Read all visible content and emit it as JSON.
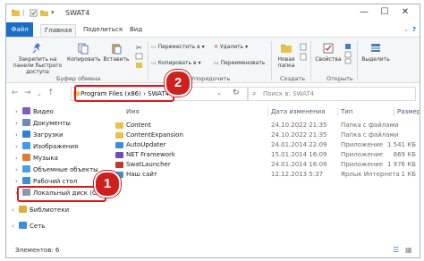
{
  "window": {
    "title": "SWAT4",
    "controls": [
      "—",
      "☐",
      "✕"
    ]
  },
  "ribbon_tabs": [
    "Файл",
    "Главная",
    "Поделиться",
    "Вид"
  ],
  "ribbon": {
    "pin_label": "Закрепить на панели быстрого доступа",
    "copy_label": "Копировать",
    "paste_label": "Вставить",
    "clipboard_group": "Буфер обмена",
    "move_to_label": "Переместить в",
    "copy_to_label": "Копировать в",
    "delete_label": "Удалить",
    "rename_label": "Переименовать",
    "organize_group": "Упорядочить",
    "new_folder_label": "Новая папка",
    "create_group": "Создать",
    "properties_label": "Свойства",
    "open_group": "Открыть",
    "select_label": "Выделить"
  },
  "address": {
    "path_part1": "Program Files (x86)",
    "separator": "›",
    "path_part2": "SWAT4",
    "search_placeholder": "Поиск в: SWAT4"
  },
  "nav": {
    "items": [
      {
        "label": "Видео",
        "color": "#7b5fc4"
      },
      {
        "label": "Документы",
        "color": "#6b8bb8"
      },
      {
        "label": "Загрузки",
        "color": "#2f7fd4"
      },
      {
        "label": "Изображения",
        "color": "#3d9be8"
      },
      {
        "label": "Музыка",
        "color": "#e07c2a"
      },
      {
        "label": "Объемные объекты",
        "color": "#4aa0e0"
      },
      {
        "label": "Рабочий стол",
        "color": "#3d8ed8"
      },
      {
        "label": "Локальный диск (C:)",
        "color": "#8a9aaa"
      },
      {
        "label": "Библиотеки",
        "color": "#d8b040"
      },
      {
        "label": "Сеть",
        "color": "#3d8ed8"
      }
    ]
  },
  "columns": {
    "name": "Имя",
    "date": "Дата изменения",
    "type": "Тип",
    "size": "Размер"
  },
  "files": [
    {
      "name": "Content",
      "date": "24.10.2022 21:35",
      "type": "Папка с файлами",
      "size": "",
      "color": "#e8c14a"
    },
    {
      "name": "ContentExpansion",
      "date": "24.10.2022 21:35",
      "type": "Папка с файлами",
      "size": "",
      "color": "#e8c14a"
    },
    {
      "name": "AutoUpdater",
      "date": "24.01.2014 22:09",
      "type": "Приложение",
      "size": "1 541 КБ",
      "color": "#3a8fd8"
    },
    {
      "name": "NET Framework",
      "date": "15.01.2014 16:09",
      "type": "Приложение",
      "size": "869 КБ",
      "color": "#6a4fb8"
    },
    {
      "name": "SwatLauncher",
      "date": "24.01.2014 16:09",
      "type": "Приложение",
      "size": "1 976 КБ",
      "color": "#c0392b"
    },
    {
      "name": "Наш сайт",
      "date": "12.12.2013 5:37",
      "type": "Ярлык Интернета",
      "size": "1 КБ",
      "color": "#3a8fd8"
    }
  ],
  "status": {
    "count": "Элементов: 6"
  },
  "annotations": {
    "badge1": "1",
    "badge2": "2"
  },
  "colors": {
    "accent": "#1a6fc4",
    "highlight": "#e01515",
    "selection": "#cce4f7"
  }
}
